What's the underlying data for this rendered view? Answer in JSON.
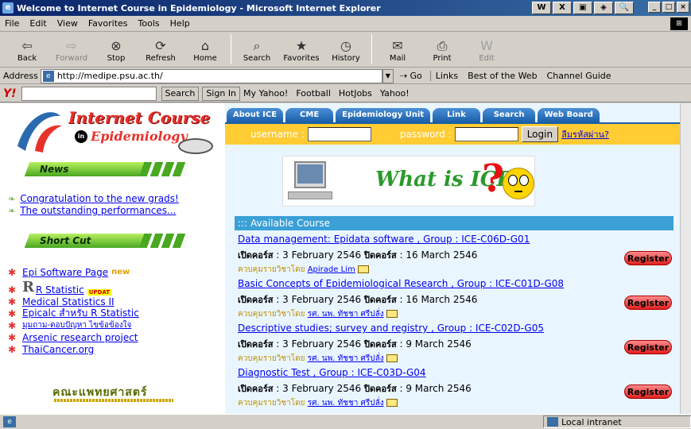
{
  "window": {
    "title": "Welcome to Internet Course in Epidemiology - Microsoft Internet Explorer"
  },
  "menu": [
    "File",
    "Edit",
    "View",
    "Favorites",
    "Tools",
    "Help"
  ],
  "toolbar": {
    "back": "Back",
    "forward": "Forward",
    "stop": "Stop",
    "refresh": "Refresh",
    "home": "Home",
    "search": "Search",
    "favorites": "Favorites",
    "history": "History",
    "mail": "Mail",
    "print": "Print",
    "edit": "Edit"
  },
  "address": {
    "label": "Address",
    "url": "http://medipe.psu.ac.th/",
    "go": "Go",
    "links_label": "Links",
    "link1": "Best of the Web",
    "link2": "Channel Guide"
  },
  "yahoo_bar": {
    "search": "Search",
    "sign_in": "Sign In",
    "my_yahoo": "My Yahoo!",
    "football": "Football",
    "hotjobs": "HotJobs",
    "yahoo": "Yahoo!"
  },
  "site": {
    "logo_line1": "Internet Course",
    "logo_in": "in",
    "logo_line2": "Epidemiology",
    "news_banner": "News",
    "news": [
      "Congratulation to the new grads!",
      "The outstanding performances..."
    ],
    "shortcut_banner": "Short Cut",
    "shortcuts": [
      {
        "label": "Epi Software Page",
        "badge": "new"
      },
      {
        "label": "R Statistic",
        "badge": "UPDAT"
      },
      {
        "label": "Medical Statistics II"
      },
      {
        "label": "Epicalc สำหรับ R Statistic"
      },
      {
        "label": "มุมถาม-ตอบปัญหา ไขข้อข้องใจ"
      },
      {
        "label": "Arsenic research project"
      },
      {
        "label": "ThaiCancer.org"
      }
    ],
    "faculty": "คณะแพทยศาสตร์"
  },
  "nav_tabs": [
    "About ICE",
    "CME",
    "Epidemiology Unit",
    "Link",
    "Search",
    "Web Board"
  ],
  "login": {
    "username_label": "username :",
    "password_label": "password :",
    "button": "Login",
    "forgot": "ลืมรหัสผ่าน?"
  },
  "what_is_ice": "What is ICE",
  "courses_header": "::: Available Course",
  "open_label": "เปิดคอร์ส",
  "close_label": "ปิดคอร์ส",
  "supervisor_label": "ควบคุมรายวิชาโดย",
  "register_label": "Register",
  "courses": [
    {
      "title": "Data management: Epidata software , Group : ICE-C06D-G01",
      "open": "3 February 2546",
      "close": "16 March 2546",
      "instructor": "Apirade Lim"
    },
    {
      "title": "Basic Concepts of Epidemiological Research , Group : ICE-C01D-G08",
      "open": "3 February 2546",
      "close": "16 March 2546",
      "instructor": "รศ. นพ. ทัชชา ศรีปลั่ง"
    },
    {
      "title": "Descriptive studies; survey and registry , Group : ICE-C02D-G05",
      "open": "3 February 2546",
      "close": "9 March 2546",
      "instructor": "รศ. นพ. ทัชชา ศรีปลั่ง"
    },
    {
      "title": "Diagnostic Test , Group : ICE-C03D-G04",
      "open": "3 February 2546",
      "close": "9 March 2546",
      "instructor": "รศ. นพ. ทัชชา ศรีปลั่ง"
    }
  ],
  "status": {
    "zone": "Local intranet"
  }
}
